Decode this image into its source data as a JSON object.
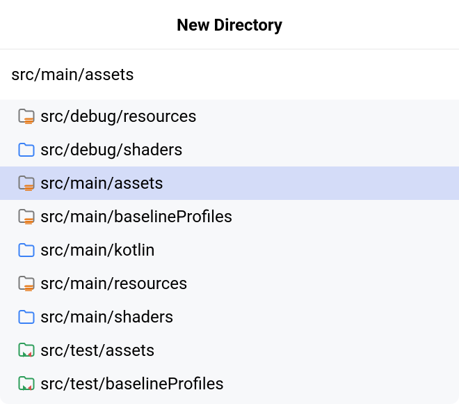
{
  "header": {
    "title": "New Directory"
  },
  "input": {
    "value": "src/main/assets"
  },
  "items": [
    {
      "label": "src/debug/resources",
      "icon": "folder-config",
      "selected": false
    },
    {
      "label": "src/debug/shaders",
      "icon": "folder-blue",
      "selected": false
    },
    {
      "label": "src/main/assets",
      "icon": "folder-config",
      "selected": true
    },
    {
      "label": "src/main/baselineProfiles",
      "icon": "folder-config",
      "selected": false
    },
    {
      "label": "src/main/kotlin",
      "icon": "folder-blue",
      "selected": false
    },
    {
      "label": "src/main/resources",
      "icon": "folder-config",
      "selected": false
    },
    {
      "label": "src/main/shaders",
      "icon": "folder-blue",
      "selected": false
    },
    {
      "label": "src/test/assets",
      "icon": "folder-test",
      "selected": false
    },
    {
      "label": "src/test/baselineProfiles",
      "icon": "folder-test",
      "selected": false
    }
  ]
}
